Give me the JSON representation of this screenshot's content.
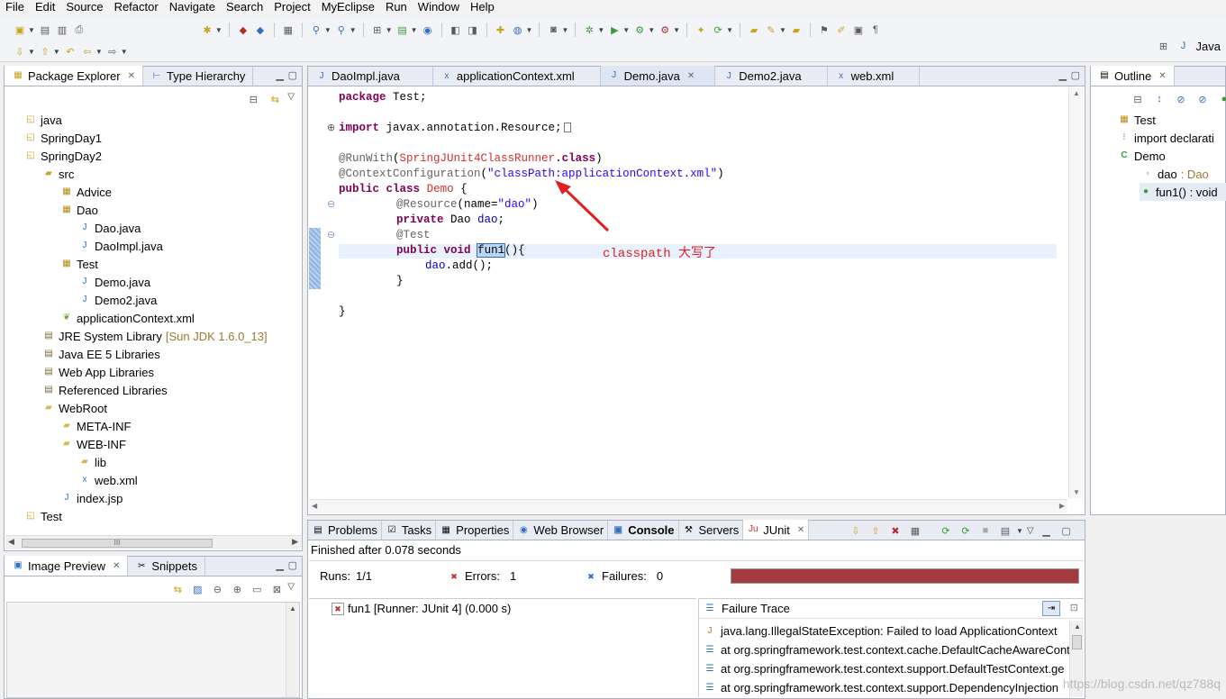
{
  "menu": [
    "File",
    "Edit",
    "Source",
    "Refactor",
    "Navigate",
    "Search",
    "Project",
    "MyEclipse",
    "Run",
    "Window",
    "Help"
  ],
  "perspective": "Java",
  "package_explorer": {
    "tabs": [
      "Package Explorer",
      "Type Hierarchy"
    ],
    "items": [
      {
        "label": "java",
        "icon": "project-icon"
      },
      {
        "label": "SpringDay1",
        "icon": "project-icon"
      },
      {
        "label": "SpringDay2",
        "icon": "project-icon"
      },
      {
        "label": "src",
        "icon": "src-folder-icon"
      },
      {
        "label": "Advice",
        "icon": "package-icon"
      },
      {
        "label": "Dao",
        "icon": "package-icon"
      },
      {
        "label": "Dao.java",
        "icon": "java-file-icon"
      },
      {
        "label": "DaoImpl.java",
        "icon": "java-file-icon"
      },
      {
        "label": "Test",
        "icon": "package-icon"
      },
      {
        "label": "Demo.java",
        "icon": "java-file-icon"
      },
      {
        "label": "Demo2.java",
        "icon": "java-file-icon"
      },
      {
        "label": "applicationContext.xml",
        "icon": "spring-leaf-icon"
      },
      {
        "label": "JRE System Library",
        "extra": "[Sun JDK 1.6.0_13]",
        "icon": "library-icon"
      },
      {
        "label": "Java EE 5 Libraries",
        "icon": "library-icon"
      },
      {
        "label": "Web App Libraries",
        "icon": "library-icon"
      },
      {
        "label": "Referenced Libraries",
        "icon": "library-icon"
      },
      {
        "label": "WebRoot",
        "icon": "folder-icon"
      },
      {
        "label": "META-INF",
        "icon": "folder-icon"
      },
      {
        "label": "WEB-INF",
        "icon": "folder-icon"
      },
      {
        "label": "lib",
        "icon": "folder-icon"
      },
      {
        "label": "web.xml",
        "icon": "xml-file-icon"
      },
      {
        "label": "index.jsp",
        "icon": "jsp-file-icon"
      },
      {
        "label": "Test",
        "icon": "project-icon"
      }
    ],
    "scroll_mark": "III"
  },
  "image_preview": {
    "tabs": [
      "Image Preview",
      "Snippets"
    ]
  },
  "editor": {
    "tabs": [
      "DaoImpl.java",
      "applicationContext.xml",
      "Demo.java",
      "Demo2.java",
      "web.xml"
    ],
    "active_tab": "Demo.java",
    "code": {
      "l1_kw": "package",
      "l1_rest": " Test;",
      "l3_kw": "import",
      "l3_rest": " javax.annotation.Resource;",
      "l5_an": "@RunWith",
      "l5_p1": "(",
      "l5_cls": "SpringJUnit4ClassRunner",
      "l5_p2": ".",
      "l5_kw": "class",
      "l5_p3": ")",
      "l6_an": "@ContextConfiguration",
      "l6_p1": "(",
      "l6_str": "\"classPath:applicationContext.xml\"",
      "l6_p2": ")",
      "l7_kw1": "public",
      "l7_kw2": "class",
      "l7_name": "Demo",
      "l7_rest": " {",
      "l8_an": "@Resource",
      "l8_p1": "(name=",
      "l8_str": "\"dao\"",
      "l8_p2": ")",
      "l9_kw": "private",
      "l9_type": " Dao ",
      "l9_fd": "dao",
      "l9_rest": ";",
      "l10_an": "@Test",
      "l11_kw1": "public",
      "l11_kw2": "void",
      "l11_name": "fun1",
      "l11_rest": "(){",
      "l12_fd": "dao",
      "l12_rest": ".add();",
      "l13": "}",
      "l15": "}"
    },
    "annotation": "classpath 大写了"
  },
  "outline": {
    "tab": "Outline",
    "items": [
      {
        "label": "Test",
        "extra": ""
      },
      {
        "label": "import declarati",
        "extra": ""
      },
      {
        "label": "Demo",
        "extra": ""
      },
      {
        "label": "dao",
        "extra": " : Dao"
      },
      {
        "label": "fun1() : void",
        "extra": ""
      }
    ]
  },
  "bottom": {
    "tabs": [
      "Problems",
      "Tasks",
      "Properties",
      "Web Browser",
      "Console",
      "Servers",
      "JUnit"
    ],
    "active_tab": "JUnit",
    "status": "Finished after 0.078 seconds",
    "runs_label": "Runs:",
    "runs_value": "1/1",
    "errors_label": "Errors:",
    "errors_value": "1",
    "failures_label": "Failures:",
    "failures_value": "0",
    "progress_color": "#a33a3f",
    "test_item": "fun1 [Runner: JUnit 4] (0.000 s)",
    "failure_trace_title": "Failure Trace",
    "trace": [
      "java.lang.IllegalStateException: Failed to load ApplicationContext",
      "at org.springframework.test.context.cache.DefaultCacheAwareCont",
      "at org.springframework.test.context.support.DefaultTestContext.ge",
      "at org.springframework.test.context.support.DependencyInjection"
    ]
  },
  "watermark": "https://blog.csdn.net/qz788q"
}
